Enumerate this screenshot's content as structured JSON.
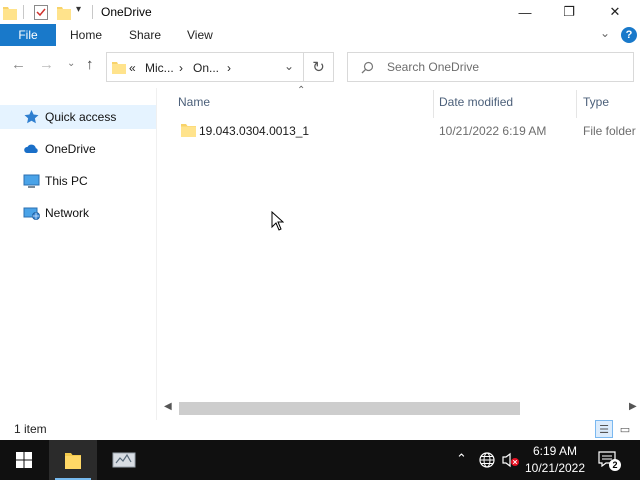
{
  "window": {
    "title": "OneDrive",
    "controls": {
      "minimize": "—",
      "maximize": "❐",
      "close": "✕"
    }
  },
  "ribbon": {
    "tabs": [
      "File",
      "Home",
      "Share",
      "View"
    ],
    "help": "?"
  },
  "address": {
    "prefix": "«",
    "crumbs": [
      "Mic...",
      "On..."
    ],
    "separator": "›"
  },
  "search": {
    "placeholder": "Search OneDrive"
  },
  "sidebar": {
    "items": [
      {
        "label": "Quick access",
        "icon": "star-icon",
        "selected": true
      },
      {
        "label": "OneDrive",
        "icon": "cloud-icon",
        "selected": false
      },
      {
        "label": "This PC",
        "icon": "computer-icon",
        "selected": false
      },
      {
        "label": "Network",
        "icon": "network-icon",
        "selected": false
      }
    ]
  },
  "columns": {
    "name": "Name",
    "date": "Date modified",
    "type": "Type"
  },
  "files": [
    {
      "name": "19.043.0304.0013_1",
      "date": "10/21/2022 6:19 AM",
      "type": "File folder",
      "icon": "folder-icon"
    }
  ],
  "status": {
    "count": "1 item"
  },
  "taskbar": {
    "time": "6:19 AM",
    "date": "10/21/2022",
    "notifications": "2"
  },
  "colors": {
    "accent": "#1979ca",
    "selection": "#e5f3ff",
    "folder": "#ffd866",
    "taskbar": "#101010"
  }
}
